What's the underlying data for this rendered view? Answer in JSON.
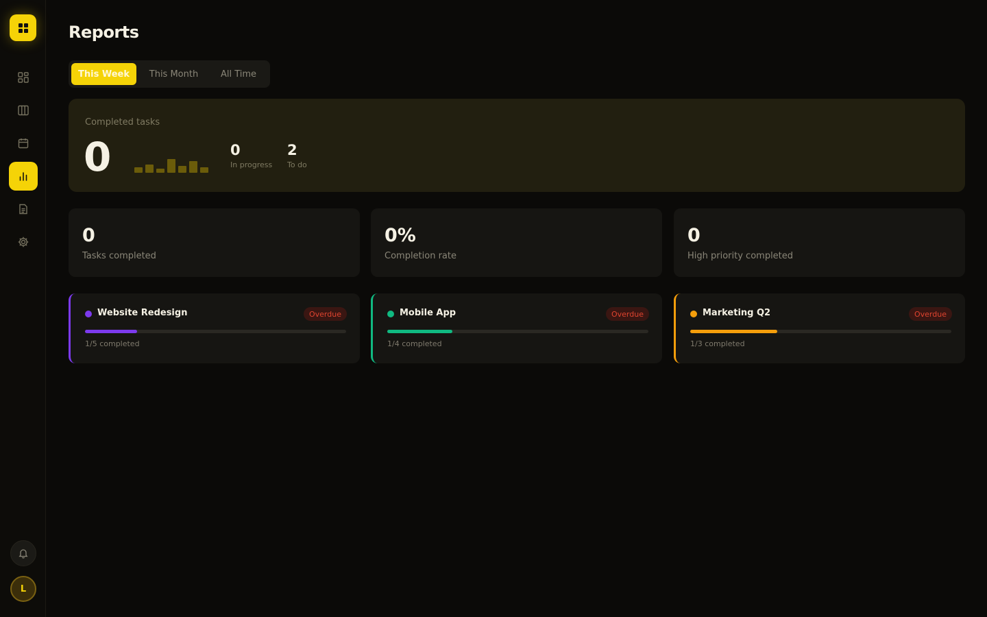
{
  "page": {
    "title": "Reports"
  },
  "tabs": [
    {
      "label": "This Week",
      "active": true
    },
    {
      "label": "This Month",
      "active": false
    },
    {
      "label": "All Time",
      "active": false
    }
  ],
  "hero": {
    "label": "Completed tasks",
    "value": "0",
    "in_progress": {
      "value": "0",
      "label": "In progress"
    },
    "todo": {
      "value": "2",
      "label": "To do"
    },
    "sparkline_levels": [
      0.35,
      0.55,
      0.25,
      0.9,
      0.45,
      0.75,
      0.38
    ]
  },
  "stats": [
    {
      "value": "0",
      "label": "Tasks completed"
    },
    {
      "value": "0%",
      "label": "Completion rate"
    },
    {
      "value": "0",
      "label": "High priority completed"
    }
  ],
  "projects": [
    {
      "name": "Website Redesign",
      "badge": "Overdue",
      "progress_text": "1/5 completed",
      "progress": 0.2,
      "color": "#7c3aed"
    },
    {
      "name": "Mobile App",
      "badge": "Overdue",
      "progress_text": "1/4 completed",
      "progress": 0.25,
      "color": "#10b981"
    },
    {
      "name": "Marketing Q2",
      "badge": "Overdue",
      "progress_text": "1/3 completed",
      "progress": 0.333,
      "color": "#f59e0b"
    }
  ],
  "sidebar": {
    "nav": [
      {
        "icon": "dashboard-icon",
        "active": false
      },
      {
        "icon": "board-columns-icon",
        "active": false
      },
      {
        "icon": "calendar-icon",
        "active": false
      },
      {
        "icon": "bar-chart-icon",
        "active": true
      },
      {
        "icon": "document-icon",
        "active": false
      },
      {
        "icon": "gear-icon",
        "active": false
      }
    ],
    "avatar_initial": "L"
  },
  "colors": {
    "accent": "#f5d307",
    "overdue": "#e0442f"
  }
}
